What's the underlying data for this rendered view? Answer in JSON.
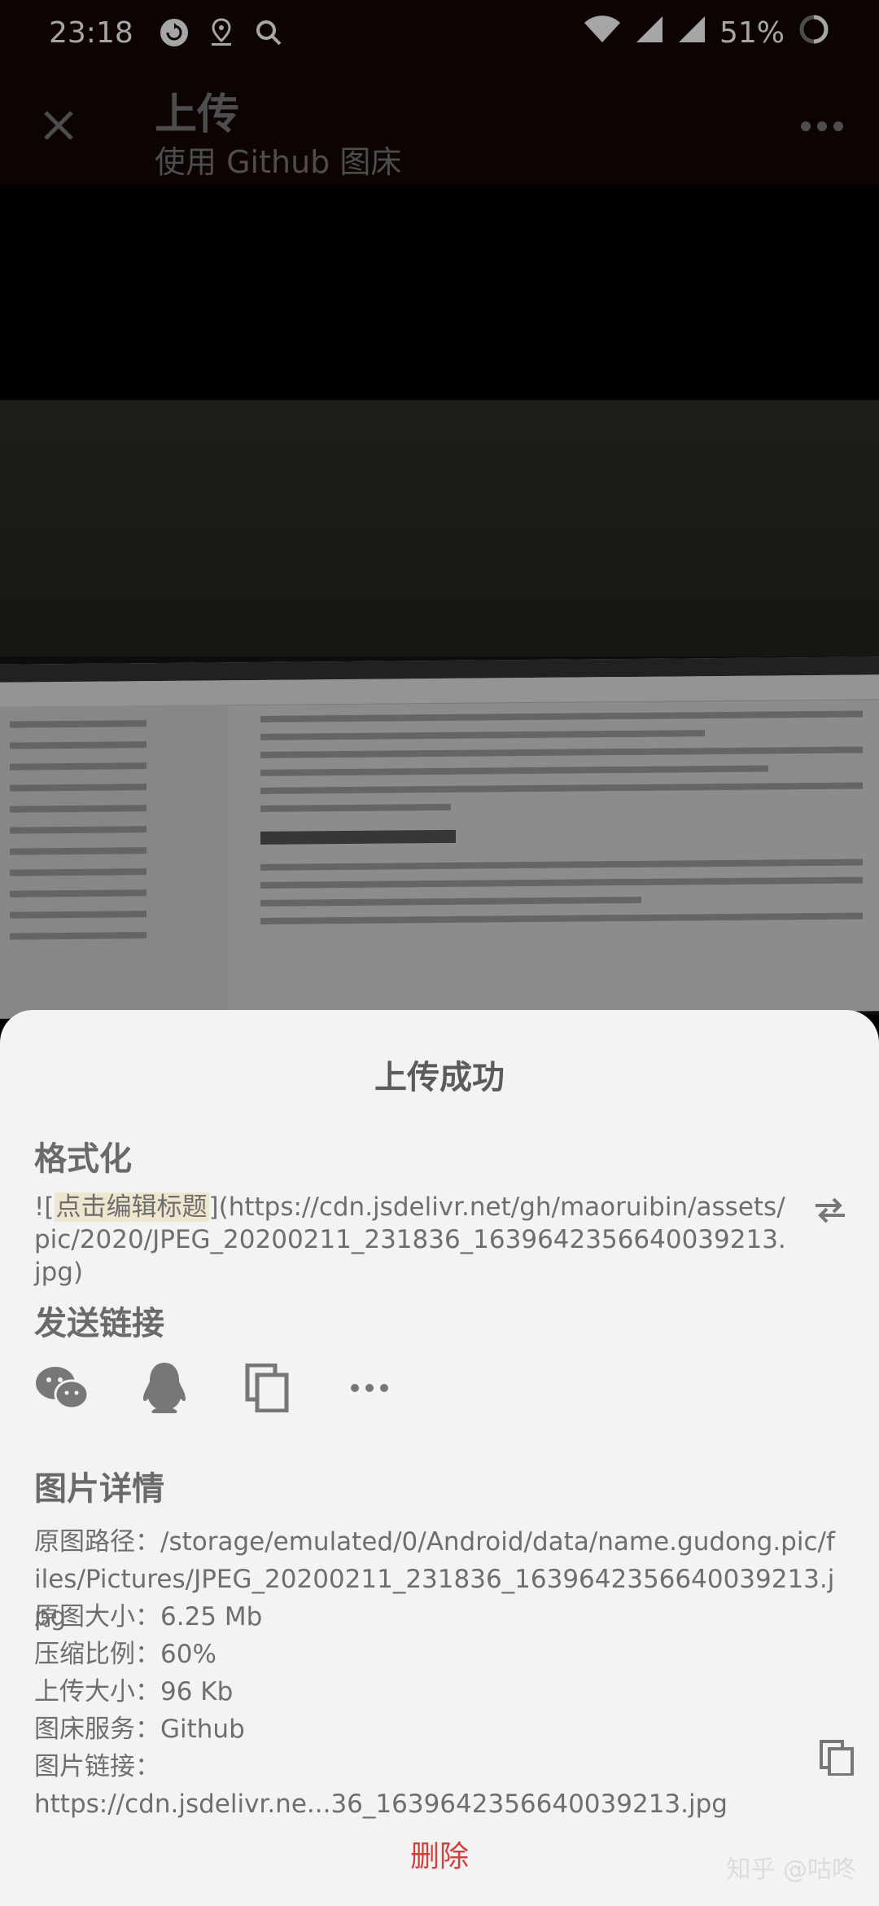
{
  "status_bar": {
    "time": "23:18",
    "battery": "51%"
  },
  "appbar": {
    "title": "上传",
    "subtitle": "使用 Github 图床"
  },
  "sheet": {
    "title": "上传成功",
    "format": {
      "heading": "格式化",
      "prefix": "![",
      "highlight": "点击编辑标题",
      "suffix": "](https://cdn.jsdelivr.net/gh/maoruibin/assets/pic/2020/JPEG_20200211_231836_1639642356640039213.jpg)"
    },
    "share": {
      "heading": "发送链接",
      "icons": [
        "wechat-icon",
        "qq-icon",
        "copy-icon",
        "more-icon"
      ]
    },
    "details": {
      "heading": "图片详情",
      "original_path_label": "原图路径：",
      "original_path": "/storage/emulated/0/Android/data/name.gudong.pic/files/Pictures/JPEG_20200211_231836_1639642356640039213.jpg",
      "original_size_label": "原图大小：",
      "original_size": "6.25 Mb",
      "compression_label": "压缩比例：",
      "compression": "60%",
      "upload_size_label": "上传大小：",
      "upload_size": "96 Kb",
      "service_label": "图床服务：",
      "service": "Github",
      "link_label": "图片链接：",
      "link": "https://cdn.jsdelivr.ne...36_1639642356640039213.jpg"
    },
    "delete_label": "删除",
    "watermark": "知乎 @咕咚"
  }
}
